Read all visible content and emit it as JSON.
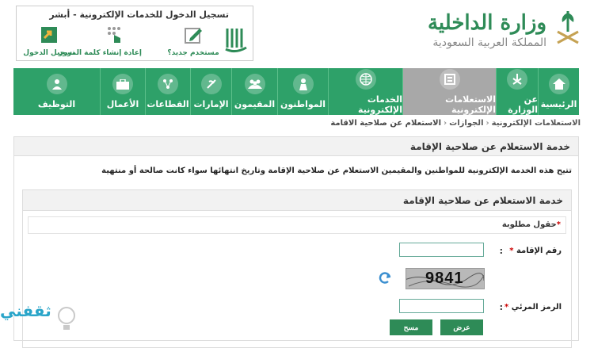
{
  "header": {
    "ministry_name": "وزارة الداخلية",
    "ministry_country": "المملكة العربية السعودية",
    "absher_title": "تسجيل الدخول للخدمات الإلكترونية - أبشر",
    "absher_links": [
      {
        "label": "مستخدم جديد؟",
        "icon": "edit-icon"
      },
      {
        "label": "إعادة إنشاء كلمة المرور",
        "icon": "keypad-icon"
      },
      {
        "label": "تسجيل الدخول",
        "icon": "login-icon"
      }
    ]
  },
  "nav": {
    "items": [
      {
        "label": "الرئيسية",
        "icon": "home-icon",
        "active": false
      },
      {
        "label": "عن الوزارة",
        "icon": "emblem-icon",
        "active": false
      },
      {
        "label": "الاستعلامات الإلكترونية",
        "icon": "inquiry-icon",
        "active": true
      },
      {
        "label": "الخدمات الإلكترونية",
        "icon": "globe-icon",
        "active": false
      },
      {
        "label": "المواطنون",
        "icon": "citizen-icon",
        "active": false
      },
      {
        "label": "المقيمون",
        "icon": "residents-icon",
        "active": false
      },
      {
        "label": "الإمارات",
        "icon": "emirates-icon",
        "active": false
      },
      {
        "label": "القطاعات",
        "icon": "sectors-icon",
        "active": false
      },
      {
        "label": "الأعمال",
        "icon": "briefcase-icon",
        "active": false
      },
      {
        "label": "التوظيف",
        "icon": "employment-icon",
        "active": false
      }
    ]
  },
  "breadcrumb": {
    "items": [
      "الاستعلامات الإلكترونية",
      "الجوازات",
      "الاستعلام عن صلاحية الاقامة"
    ]
  },
  "service": {
    "title": "خدمة الاستعلام عن صلاحية الإقامة",
    "description": "تتيح هذه الخدمة الإلكترونية للمواطنين والمقيمين الاستعلام عن صلاحية الإقامة وتاريخ انتهائها سواء كانت صالحة أو منتهية",
    "form_title": "خدمة الاستعلام عن صلاحية الإقامة",
    "required_note": "حقول مطلوبة",
    "iqama_label": "رقم الإقامة",
    "iqama_value": "",
    "captcha_label": "الرمز المرئي",
    "captcha_value": "",
    "captcha_text": "9841",
    "colon": ":",
    "submit_label": "عرض",
    "clear_label": "مسح"
  },
  "watermark": {
    "text": "ثقفني"
  },
  "colors": {
    "brand_green": "#2ea169",
    "active_nav": "#a8a8a8",
    "required_red": "#cc0000"
  }
}
